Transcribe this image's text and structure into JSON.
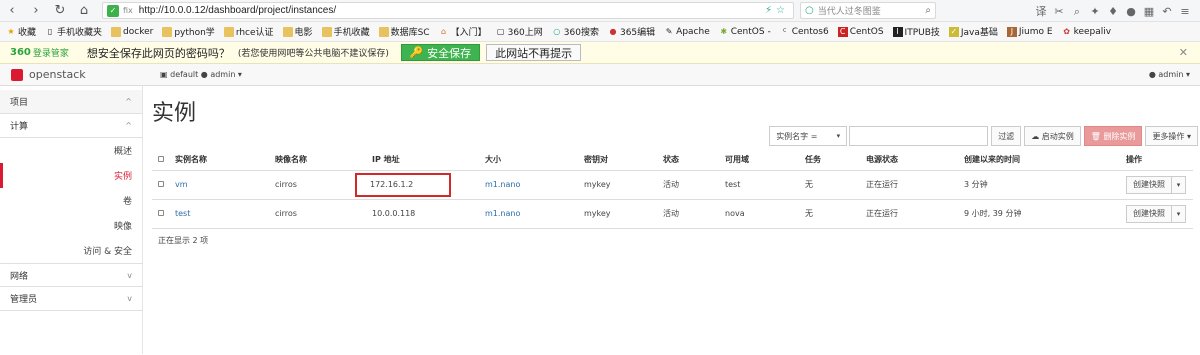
{
  "browser": {
    "url": "http://10.0.0.12/dashboard/project/instances/",
    "search_placeholder": "当代人过冬图鉴",
    "bookmarks": [
      "收藏",
      "手机收藏夹",
      "docker",
      "python学",
      "rhce认证",
      "电影",
      "手机收藏",
      "数据库SC",
      "【入门】",
      "360上网",
      "360搜索",
      "365编辑",
      "Apache",
      "CentOS -",
      "Centos6",
      "CentOS",
      "ITPUB技",
      "Java基础",
      "Jiumo E",
      "keepaliv"
    ]
  },
  "password_bar": {
    "logo": "360",
    "logo_sub": "登录管家",
    "question": "想安全保存此网页的密码吗？",
    "hint": "(若您使用网吧等公共电脑不建议保存)",
    "save_label": "安全保存",
    "never_label": "此网站不再提示"
  },
  "header": {
    "logo": "openstack",
    "project": "default ● admin ▾",
    "user": "admin ▾"
  },
  "sidebar": {
    "project": "项目",
    "compute": "计算",
    "items": [
      "概述",
      "实例",
      "卷",
      "映像",
      "访问 & 安全"
    ],
    "network": "网络",
    "admin": "管理员"
  },
  "page": {
    "title": "实例",
    "filter_select": "实例名字 =",
    "filter_button": "过滤",
    "launch_button": "启动实例",
    "delete_button": "删除实例",
    "more_button": "更多操作 ▾",
    "summary": "正在显示 2 项"
  },
  "table": {
    "headers": [
      "实例名称",
      "映像名称",
      "IP 地址",
      "大小",
      "密钥对",
      "状态",
      "可用域",
      "任务",
      "电源状态",
      "创建以来的时间",
      "操作"
    ],
    "rows": [
      {
        "name": "vm",
        "image": "cirros",
        "ip": "172.16.1.2",
        "size": "m1.nano",
        "key": "mykey",
        "status": "活动",
        "zone": "test",
        "task": "无",
        "power": "正在运行",
        "age": "3 分钟",
        "action": "创建快照"
      },
      {
        "name": "test",
        "image": "cirros",
        "ip": "10.0.0.118",
        "size": "m1.nano",
        "key": "mykey",
        "status": "活动",
        "zone": "nova",
        "task": "无",
        "power": "正在运行",
        "age": "9 小时, 39 分钟",
        "action": "创建快照"
      }
    ]
  }
}
